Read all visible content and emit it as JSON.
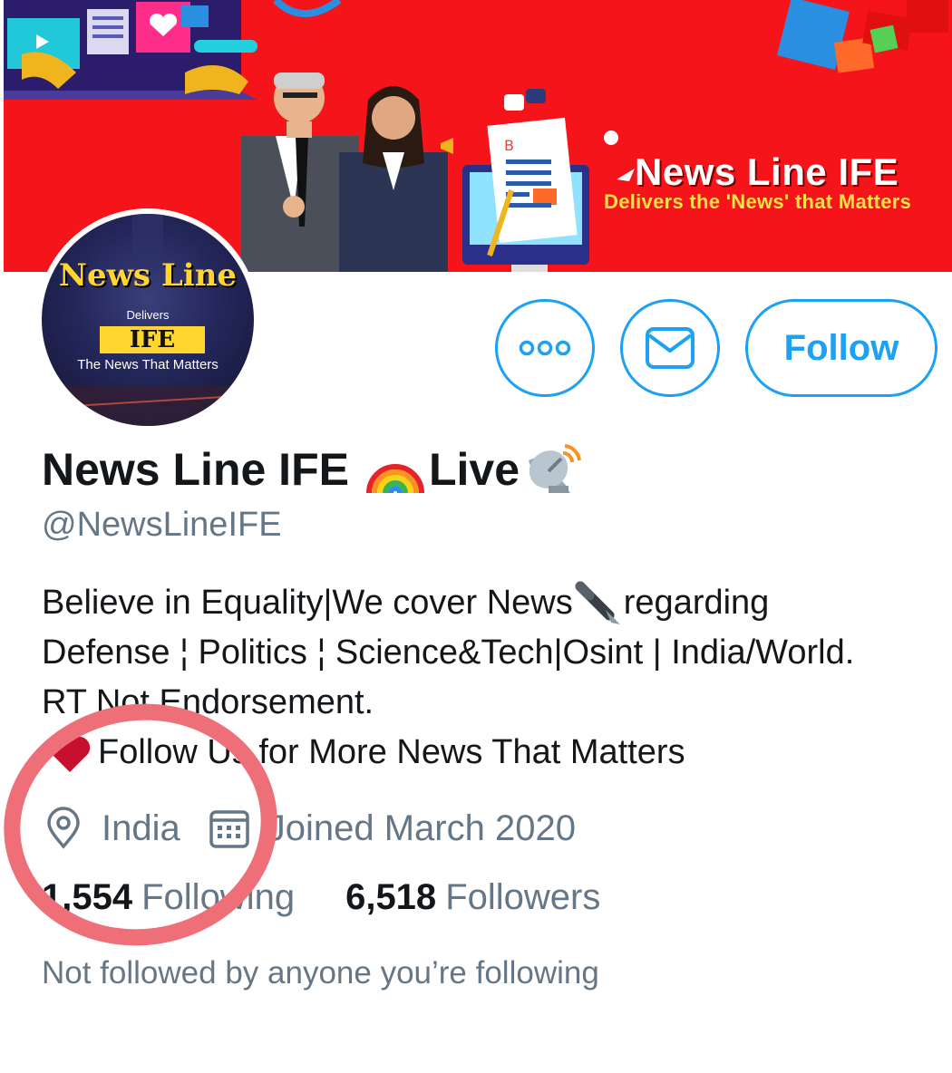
{
  "banner": {
    "title": "News Line IFE",
    "subtitle": "Delivers the 'News' that Matters"
  },
  "avatar": {
    "brand": "News Line",
    "delivers": "Delivers",
    "ife": "IFE",
    "tagline": "The News That Matters"
  },
  "actions": {
    "more_icon": "more-dots-icon",
    "message_icon": "envelope-icon",
    "follow_label": "Follow"
  },
  "profile": {
    "name_prefix": "News Line IFE",
    "name_suffix": "Live",
    "name_emojis": [
      "rainbow-icon",
      "satellite-dish-icon"
    ],
    "handle": "@NewsLineIFE",
    "bio_line1_a": "Believe in Equality|We cover News",
    "bio_line1_b": " regarding",
    "bio_line2": "Defense ¦ Politics ¦ Science&Tech|Osint | India/World.",
    "bio_line3": "RT Not Endorsement.",
    "bio_line4": "Follow Us for More News That Matters",
    "location": "India",
    "joined": "Joined March 2020",
    "following_count": "1,554",
    "following_label": "Following",
    "followers_count": "6,518",
    "followers_label": "Followers",
    "mutual_note": "Not followed by anyone you’re following"
  },
  "colors": {
    "accent": "#1da1f2",
    "banner_red": "#f4141a",
    "muted": "#657786",
    "annotation": "#ee6f78"
  }
}
